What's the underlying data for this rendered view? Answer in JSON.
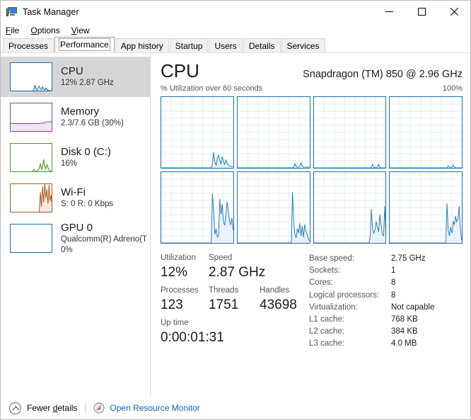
{
  "window": {
    "title": "Task Manager",
    "icon": "task-manager-icon",
    "minimize_label": "—",
    "maximize_label": "□",
    "close_label": "✕"
  },
  "menu": [
    {
      "label": "File",
      "accel": "F"
    },
    {
      "label": "Options",
      "accel": "O"
    },
    {
      "label": "View",
      "accel": "V"
    }
  ],
  "tabs": [
    {
      "label": "Processes",
      "active": false
    },
    {
      "label": "Performance",
      "active": true
    },
    {
      "label": "App history",
      "active": false
    },
    {
      "label": "Startup",
      "active": false
    },
    {
      "label": "Users",
      "active": false
    },
    {
      "label": "Details",
      "active": false
    },
    {
      "label": "Services",
      "active": false
    }
  ],
  "sidebar": {
    "items": [
      {
        "name": "cpu",
        "title": "CPU",
        "line2": "12% 2.87 GHz",
        "line3": "",
        "selected": true,
        "color": "#1a6fa8"
      },
      {
        "name": "memory",
        "title": "Memory",
        "line2": "2.3/7.6 GB (30%)",
        "line3": "",
        "selected": false,
        "color": "#8b3fa8"
      },
      {
        "name": "disk-0-c",
        "title": "Disk 0 (C:)",
        "line2": "16%",
        "line3": "",
        "selected": false,
        "color": "#4a9a28"
      },
      {
        "name": "wifi",
        "title": "Wi-Fi",
        "line2": "S: 0 R: 0 Kbps",
        "line3": "",
        "selected": false,
        "color": "#a85a18"
      },
      {
        "name": "gpu-0",
        "title": "GPU 0",
        "line2": "Qualcomm(R) Adreno(T",
        "line3": "0%",
        "selected": false,
        "color": "#1a6fa8"
      }
    ]
  },
  "main": {
    "heading": "CPU",
    "model": "Snapdragon (TM) 850 @ 2.96 GHz",
    "graph_caption": "% Utilization over 60 seconds",
    "graph_max": "100%",
    "stats": {
      "utilization_label": "Utilization",
      "utilization_value": "12%",
      "speed_label": "Speed",
      "speed_value": "2.87 GHz",
      "processes_label": "Processes",
      "processes_value": "123",
      "threads_label": "Threads",
      "threads_value": "1751",
      "handles_label": "Handles",
      "handles_value": "43698",
      "uptime_label": "Up time",
      "uptime_value": "0:00:01:31"
    },
    "specs": [
      {
        "key": "Base speed:",
        "value": "2.75 GHz"
      },
      {
        "key": "Sockets:",
        "value": "1"
      },
      {
        "key": "Cores:",
        "value": "8"
      },
      {
        "key": "Logical processors:",
        "value": "8"
      },
      {
        "key": "Virtualization:",
        "value": "Not capable"
      },
      {
        "key": "L1 cache:",
        "value": "768 KB"
      },
      {
        "key": "L2 cache:",
        "value": "384 KB"
      },
      {
        "key": "L3 cache:",
        "value": "4.0 MB"
      }
    ]
  },
  "statusbar": {
    "fewer_details": "Fewer details",
    "fewer_details_accel": "d",
    "open_resource_monitor": "Open Resource Monitor",
    "link_color": "#1060b8"
  },
  "chart_data": [
    {
      "type": "area",
      "title": "Logical processor 0",
      "ylabel": "% Utilization",
      "xlabel": "60 seconds",
      "ylim": [
        0,
        100
      ],
      "grid": true,
      "values": [
        0,
        0,
        0,
        0,
        0,
        0,
        0,
        0,
        0,
        0,
        0,
        0,
        0,
        0,
        0,
        0,
        0,
        0,
        0,
        0,
        0,
        0,
        0,
        0,
        0,
        0,
        0,
        0,
        0,
        0,
        0,
        0,
        0,
        0,
        0,
        0,
        0,
        0,
        0,
        0,
        0,
        0,
        5,
        22,
        8,
        4,
        14,
        18,
        10,
        6,
        16,
        9,
        5,
        11,
        7,
        4,
        3,
        2,
        2,
        2
      ]
    },
    {
      "type": "area",
      "title": "Logical processor 1",
      "ylabel": "% Utilization",
      "xlabel": "60 seconds",
      "ylim": [
        0,
        100
      ],
      "grid": true,
      "values": [
        0,
        0,
        0,
        0,
        0,
        0,
        0,
        0,
        0,
        0,
        0,
        0,
        0,
        0,
        0,
        0,
        0,
        0,
        0,
        0,
        0,
        0,
        0,
        0,
        0,
        0,
        0,
        0,
        0,
        0,
        0,
        0,
        0,
        0,
        0,
        0,
        0,
        0,
        0,
        0,
        0,
        0,
        0,
        0,
        0,
        0,
        1,
        6,
        2,
        1,
        1,
        2,
        7,
        3,
        1,
        1,
        1,
        1,
        1,
        1
      ]
    },
    {
      "type": "area",
      "title": "Logical processor 2",
      "ylabel": "% Utilization",
      "xlabel": "60 seconds",
      "ylim": [
        0,
        100
      ],
      "grid": true,
      "values": [
        0,
        0,
        0,
        0,
        0,
        0,
        0,
        0,
        0,
        0,
        0,
        0,
        0,
        0,
        0,
        0,
        0,
        0,
        0,
        0,
        0,
        0,
        0,
        0,
        0,
        0,
        0,
        0,
        0,
        0,
        0,
        0,
        0,
        0,
        0,
        0,
        0,
        0,
        0,
        0,
        0,
        0,
        0,
        0,
        0,
        0,
        0,
        1,
        5,
        1,
        0,
        1,
        1,
        5,
        1,
        0,
        0,
        0,
        0,
        0
      ]
    },
    {
      "type": "area",
      "title": "Logical processor 3",
      "ylabel": "% Utilization",
      "xlabel": "60 seconds",
      "ylim": [
        0,
        100
      ],
      "grid": true,
      "values": [
        0,
        0,
        0,
        0,
        0,
        0,
        0,
        0,
        0,
        0,
        0,
        0,
        0,
        0,
        0,
        0,
        0,
        0,
        0,
        0,
        0,
        0,
        0,
        0,
        0,
        0,
        0,
        0,
        0,
        0,
        0,
        0,
        0,
        0,
        0,
        0,
        0,
        0,
        0,
        0,
        0,
        0,
        0,
        0,
        0,
        0,
        0,
        0,
        3,
        1,
        0,
        1,
        4,
        1,
        0,
        0,
        0,
        0,
        0,
        0
      ]
    },
    {
      "type": "area",
      "title": "Logical processor 4",
      "ylabel": "% Utilization",
      "xlabel": "60 seconds",
      "ylim": [
        0,
        100
      ],
      "grid": true,
      "values": [
        0,
        0,
        0,
        0,
        0,
        0,
        0,
        0,
        0,
        0,
        0,
        0,
        0,
        0,
        0,
        0,
        0,
        0,
        0,
        0,
        0,
        0,
        0,
        0,
        0,
        0,
        0,
        0,
        0,
        0,
        0,
        0,
        0,
        0,
        0,
        0,
        0,
        0,
        0,
        0,
        0,
        0,
        70,
        45,
        12,
        20,
        8,
        10,
        62,
        40,
        55,
        30,
        25,
        38,
        58,
        44,
        30,
        26,
        35,
        18
      ]
    },
    {
      "type": "area",
      "title": "Logical processor 5",
      "ylabel": "% Utilization",
      "xlabel": "60 seconds",
      "ylim": [
        0,
        100
      ],
      "grid": true,
      "values": [
        0,
        0,
        0,
        0,
        0,
        0,
        0,
        0,
        0,
        0,
        0,
        0,
        0,
        0,
        0,
        0,
        0,
        0,
        0,
        0,
        0,
        0,
        0,
        0,
        0,
        0,
        0,
        0,
        0,
        0,
        0,
        0,
        0,
        0,
        0,
        0,
        0,
        0,
        0,
        0,
        0,
        0,
        0,
        0,
        0,
        72,
        30,
        12,
        8,
        20,
        14,
        28,
        10,
        24,
        8,
        26,
        16,
        12,
        6,
        3
      ]
    },
    {
      "type": "area",
      "title": "Logical processor 6",
      "ylabel": "% Utilization",
      "xlabel": "60 seconds",
      "ylim": [
        0,
        100
      ],
      "grid": true,
      "values": [
        0,
        0,
        0,
        0,
        0,
        0,
        0,
        0,
        0,
        0,
        0,
        0,
        0,
        0,
        0,
        0,
        0,
        0,
        0,
        0,
        0,
        0,
        0,
        0,
        0,
        0,
        0,
        0,
        0,
        0,
        0,
        0,
        0,
        0,
        0,
        0,
        0,
        0,
        0,
        0,
        0,
        0,
        0,
        0,
        0,
        0,
        8,
        48,
        20,
        14,
        18,
        30,
        22,
        16,
        40,
        26,
        12,
        10,
        52,
        6
      ]
    },
    {
      "type": "area",
      "title": "Logical processor 7",
      "ylabel": "% Utilization",
      "xlabel": "60 seconds",
      "ylim": [
        0,
        100
      ],
      "grid": true,
      "values": [
        0,
        0,
        0,
        0,
        0,
        0,
        0,
        0,
        0,
        0,
        0,
        0,
        0,
        0,
        0,
        0,
        0,
        0,
        0,
        0,
        0,
        0,
        0,
        0,
        0,
        0,
        0,
        0,
        0,
        0,
        0,
        0,
        0,
        0,
        0,
        0,
        0,
        0,
        0,
        0,
        0,
        0,
        0,
        0,
        0,
        0,
        0,
        56,
        18,
        10,
        22,
        14,
        30,
        26,
        38,
        30,
        34,
        52,
        20,
        4
      ]
    }
  ],
  "sidebar_sparklines": {
    "cpu": [
      0,
      0,
      0,
      0,
      0,
      0,
      0,
      0,
      0,
      0,
      0,
      0,
      0,
      0,
      0,
      0,
      0,
      0,
      0,
      0,
      0,
      0,
      5,
      22,
      8,
      4,
      14,
      18,
      10,
      6,
      16,
      9,
      5,
      11,
      7,
      4,
      3,
      2,
      2,
      2
    ],
    "memory": [
      28,
      28,
      28,
      28,
      28,
      28,
      28,
      28,
      28,
      28,
      28,
      28,
      28,
      28,
      28,
      28,
      28,
      28,
      28,
      28,
      28,
      28,
      28,
      28,
      28,
      28,
      28,
      28,
      28,
      30,
      30,
      30,
      30,
      34,
      34,
      34,
      34,
      34,
      34,
      34
    ],
    "disk": [
      0,
      0,
      0,
      0,
      0,
      0,
      0,
      0,
      0,
      0,
      0,
      0,
      0,
      0,
      0,
      0,
      0,
      0,
      0,
      0,
      0,
      4,
      10,
      6,
      3,
      2,
      8,
      14,
      30,
      10,
      20,
      44,
      22,
      12,
      26,
      16,
      8,
      4,
      2,
      1
    ],
    "wifi": [
      0,
      0,
      0,
      0,
      0,
      0,
      0,
      0,
      0,
      0,
      0,
      0,
      0,
      0,
      0,
      0,
      0,
      0,
      0,
      0,
      0,
      0,
      0,
      0,
      0,
      0,
      0,
      0,
      70,
      20,
      90,
      35,
      100,
      50,
      80,
      30,
      95,
      40,
      60,
      15
    ],
    "gpu": [
      0,
      0,
      0,
      0,
      0,
      0,
      0,
      0,
      0,
      0,
      0,
      0,
      0,
      0,
      0,
      0,
      0,
      0,
      0,
      0,
      0,
      0,
      0,
      0,
      0,
      0,
      0,
      0,
      0,
      0,
      0,
      0,
      0,
      0,
      0,
      0,
      0,
      0,
      0,
      0
    ]
  }
}
